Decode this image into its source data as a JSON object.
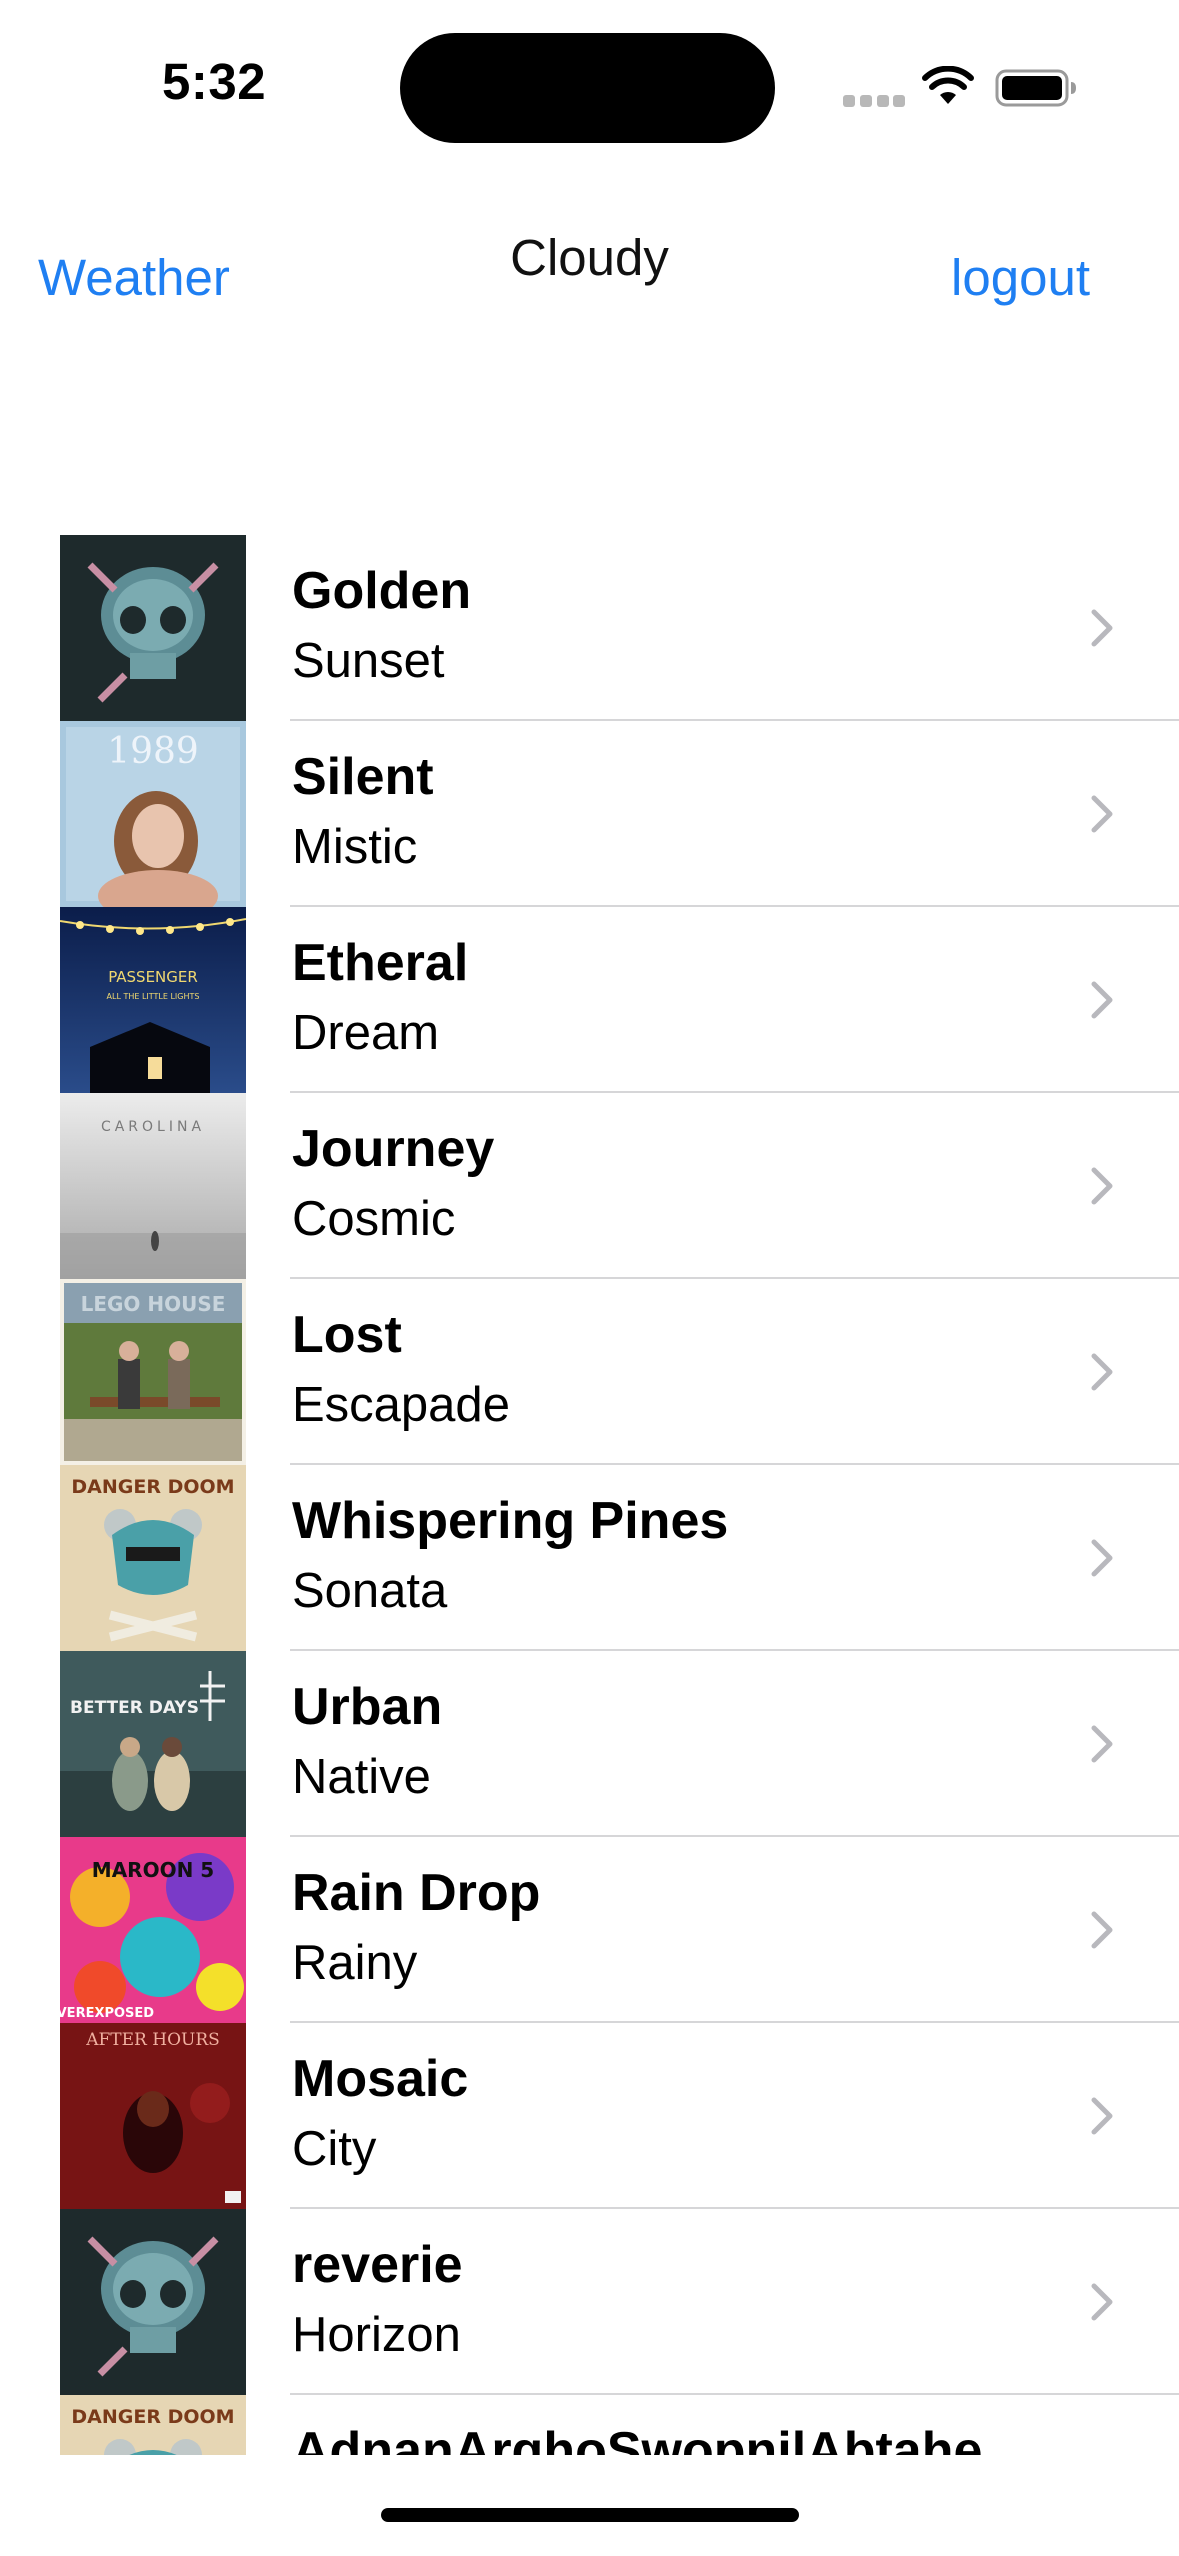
{
  "status_bar": {
    "time": "5:32"
  },
  "nav": {
    "left_label": "Weather",
    "title": "Cloudy",
    "right_label": "logout",
    "accent_color": "#1f7ff2"
  },
  "rows": [
    {
      "title": "Golden",
      "subtitle": "Sunset",
      "art": "skull-crystal-album-art"
    },
    {
      "title": "Silent",
      "subtitle": "Mistic",
      "art": "1989-portrait-album-art"
    },
    {
      "title": "Etheral",
      "subtitle": "Dream",
      "art": "passenger-night-house-album-art"
    },
    {
      "title": "Journey",
      "subtitle": "Cosmic",
      "art": "carolina-foggy-field-album-art"
    },
    {
      "title": "Lost",
      "subtitle": "Escapade",
      "art": "lego-house-bench-album-art"
    },
    {
      "title": "Whispering Pines",
      "subtitle": "Sonata",
      "art": "danger-doom-mask-album-art"
    },
    {
      "title": "Urban",
      "subtitle": "Native",
      "art": "better-days-album-art"
    },
    {
      "title": "Rain Drop",
      "subtitle": "Rainy",
      "art": "overexposed-colorful-album-art"
    },
    {
      "title": "Mosaic",
      "subtitle": "City",
      "art": "after-hours-red-album-art"
    },
    {
      "title": "reverie",
      "subtitle": "Horizon",
      "art": "skull-crystal-album-art"
    },
    {
      "title": "AdnanArghoSwopnilAbtahe",
      "subtitle": "",
      "art": "danger-doom-mask-album-art"
    }
  ],
  "art_text": {
    "passenger": "PASSENGER",
    "passenger_sub": "ALL THE LITTLE LIGHTS",
    "carolina": "CAROLINA",
    "lego": "LEGO HOUSE",
    "danger": "DANGER DOOM",
    "better": "BETTER DAYS",
    "maroon": "MAROON 5",
    "overexposed": "OVEREXPOSED",
    "after": "AFTER HOURS",
    "nineteen": "1989"
  }
}
